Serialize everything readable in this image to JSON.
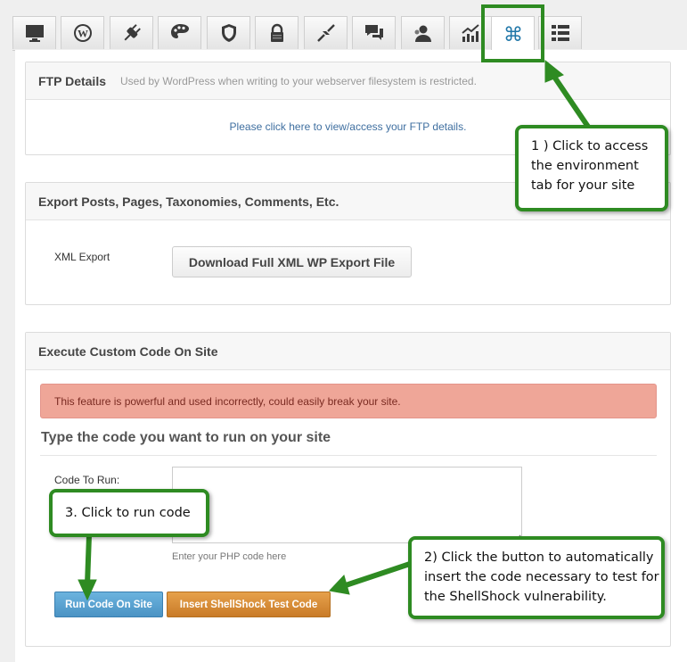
{
  "tabs": [
    {
      "icon": "monitor-icon",
      "title": "Dashboard"
    },
    {
      "icon": "wordpress-icon",
      "title": "WordPress"
    },
    {
      "icon": "plugin-icon",
      "title": "Plugins"
    },
    {
      "icon": "palette-icon",
      "title": "Themes"
    },
    {
      "icon": "shield-icon",
      "title": "Security"
    },
    {
      "icon": "lock-icon",
      "title": "Lock"
    },
    {
      "icon": "compress-icon",
      "title": "Optimize"
    },
    {
      "icon": "chat-icon",
      "title": "Comments"
    },
    {
      "icon": "users-icon",
      "title": "Users"
    },
    {
      "icon": "chart-icon",
      "title": "Analytics"
    },
    {
      "icon": "command-icon",
      "title": "Environment",
      "active": true
    },
    {
      "icon": "list-icon",
      "title": "List"
    }
  ],
  "ftp": {
    "title": "FTP Details",
    "subtitle": "Used by WordPress when writing to your webserver filesystem is restricted.",
    "link": "Please click here to view/access your FTP details."
  },
  "export": {
    "title": "Export Posts, Pages, Taxonomies, Comments, Etc.",
    "label": "XML Export",
    "button": "Download Full XML WP Export File"
  },
  "custom_code": {
    "title": "Execute Custom Code On Site",
    "warning": "This feature is powerful and used incorrectly, could easily break your site.",
    "heading": "Type the code you want to run on your site",
    "label": "Code To Run:",
    "textarea_value": "",
    "hint": "Enter your PHP code here",
    "run_button": "Run Code On Site",
    "insert_button": "Insert ShellShock Test Code"
  },
  "callouts": {
    "one": [
      "1 ) Click to access",
      "the environment",
      "tab for your site"
    ],
    "two": [
      "2) Click the button to automatically",
      "insert the code necessary to test for",
      "the ShellShock vulnerability."
    ],
    "three": [
      "3. Click to run code"
    ]
  },
  "colors": {
    "callout_border": "#2e8b22",
    "link": "#3f6fa0",
    "alert_bg": "#efa698",
    "run_button": "#5aa3d2",
    "insert_button": "#d88d38"
  }
}
